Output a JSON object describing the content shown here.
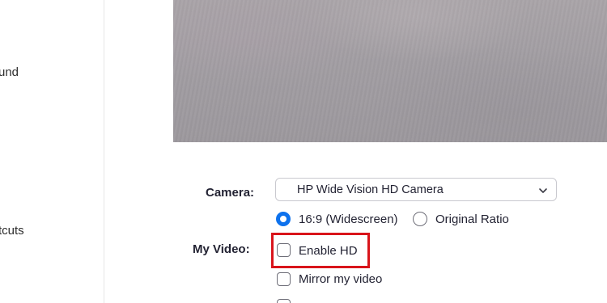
{
  "sidebar": {
    "items": [
      {
        "label": "und"
      },
      {
        "label": "tcuts"
      }
    ]
  },
  "settings": {
    "camera": {
      "label": "Camera:",
      "selected_device": "HP Wide Vision HD Camera",
      "chevron_icon": "chevron-down-icon"
    },
    "aspect_ratio": {
      "options": [
        {
          "label": "16:9 (Widescreen)",
          "selected": true
        },
        {
          "label": "Original Ratio",
          "selected": false
        }
      ]
    },
    "my_video": {
      "label": "My Video:",
      "options": [
        {
          "label": "Enable HD",
          "checked": false,
          "highlighted": true
        },
        {
          "label": "Mirror my video",
          "checked": false
        },
        {
          "label": "",
          "checked": false
        }
      ]
    }
  },
  "colors": {
    "accent": "#0e72ed",
    "highlight_border": "#d9141b"
  }
}
